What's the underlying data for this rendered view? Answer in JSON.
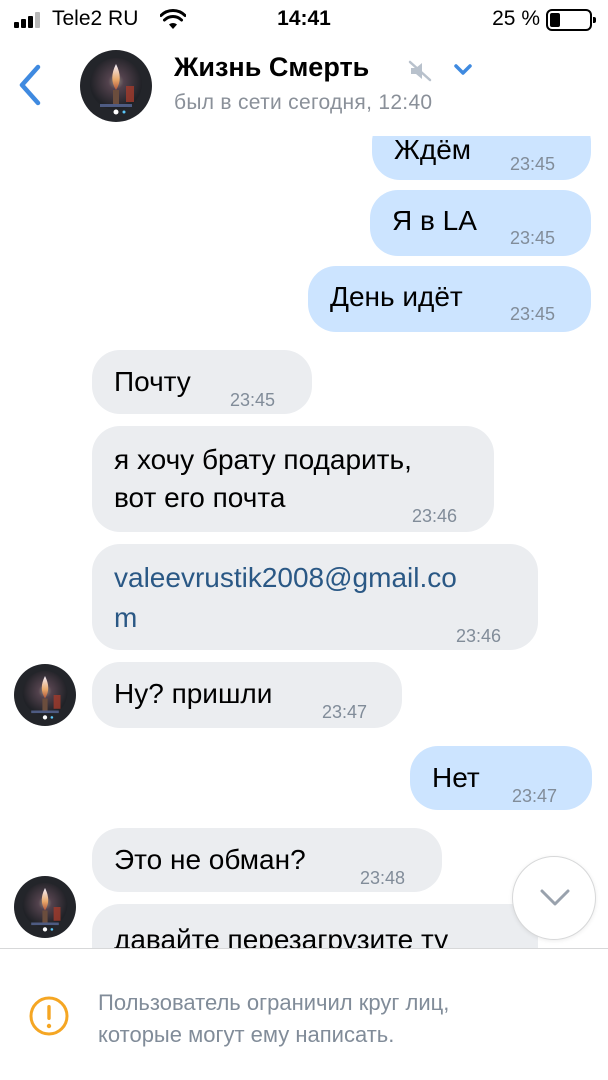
{
  "status_bar": {
    "carrier": "Tele2 RU",
    "time": "14:41",
    "battery_percent": "25 %",
    "battery_level": 0.25,
    "icons": [
      "signal-icon",
      "wifi-icon",
      "battery-icon"
    ]
  },
  "header": {
    "back_icon": "chevron-left-icon",
    "title": "Жизнь Смерть",
    "muted_icon": "muted-speaker-icon",
    "dropdown_icon": "chevron-down-icon",
    "status": "был в сети сегодня, 12:40"
  },
  "messages": [
    {
      "direction": "out",
      "text": "Ждём",
      "time": "23:45"
    },
    {
      "direction": "out",
      "text": "Я в LA",
      "time": "23:45"
    },
    {
      "direction": "out",
      "text": "День идёт",
      "time": "23:45"
    },
    {
      "direction": "in",
      "text": "Почту",
      "time": "23:45"
    },
    {
      "direction": "in",
      "lines": [
        "я хочу брату подарить,",
        "вот его почта"
      ],
      "time": "23:46"
    },
    {
      "direction": "in",
      "lines": [
        "valeevrustik2008@gmail.co",
        "m"
      ],
      "time": "23:46",
      "is_link": true
    },
    {
      "direction": "in",
      "text": "Ну? пришли",
      "time": "23:47"
    },
    {
      "direction": "out",
      "text": "Нет",
      "time": "23:47"
    },
    {
      "direction": "in",
      "text": "Это не обман?",
      "time": "23:48"
    },
    {
      "direction": "in",
      "text": "давайте перезагрузите ту",
      "time": ""
    }
  ],
  "scroll_down_icon": "chevron-down-icon",
  "footer": {
    "icon": "warning-icon",
    "lines": [
      "Пользователь ограничил круг лиц,",
      "которые могут ему написать."
    ]
  },
  "colors": {
    "accent": "#3f8ae0",
    "outgoing_bubble": "#cce4ff",
    "incoming_bubble": "#ebedf0",
    "secondary_text": "#818c99",
    "link": "#2a5885",
    "warning": "#f5a623"
  }
}
